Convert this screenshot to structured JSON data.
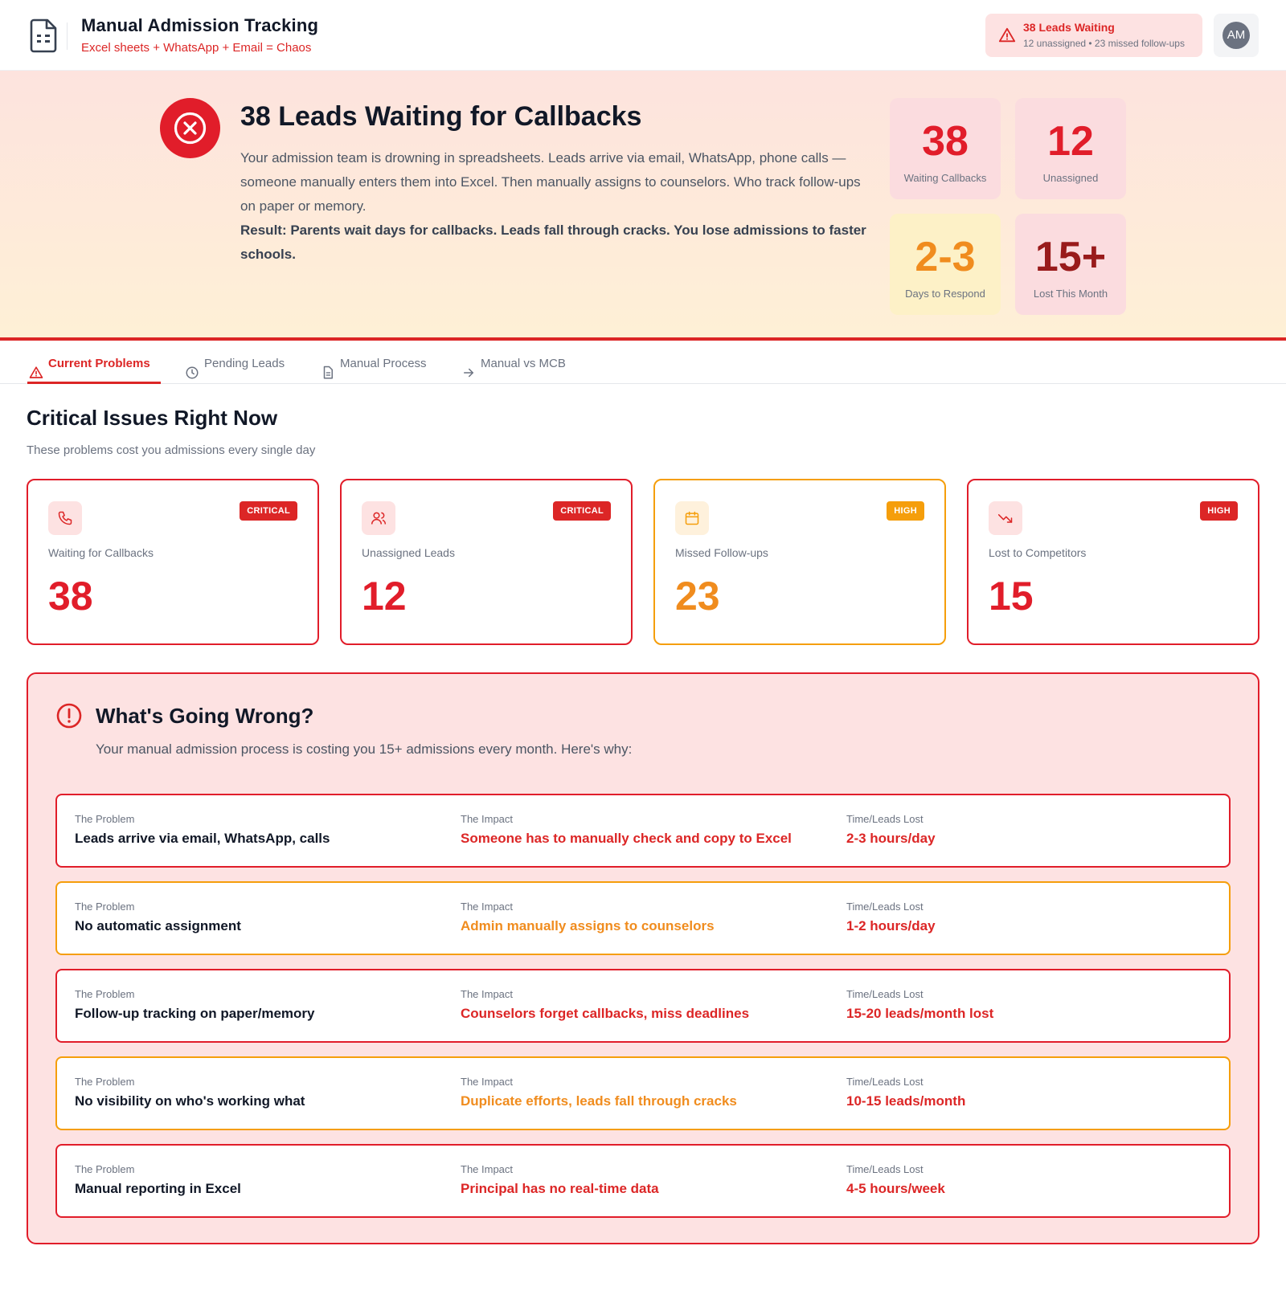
{
  "header": {
    "title": "Manual Admission Tracking",
    "subtitle": "Excel sheets + WhatsApp + Email = Chaos",
    "alert_title": "38 Leads Waiting",
    "alert_sub": "12 unassigned • 23 missed follow-ups",
    "avatar_initials": "AM"
  },
  "hero": {
    "title": "38 Leads Waiting for Callbacks",
    "body": "Your admission team is drowning in spreadsheets. Leads arrive via email, WhatsApp, phone calls — someone manually enters them into Excel. Then manually assigns to counselors. Who track follow-ups on paper or memory.",
    "result": "Result: Parents wait days for callbacks. Leads fall through cracks. You lose admissions to faster schools.",
    "stats": [
      {
        "value": "38",
        "label": "Waiting Callbacks"
      },
      {
        "value": "12",
        "label": "Unassigned"
      },
      {
        "value": "2-3",
        "label": "Days to Respond"
      },
      {
        "value": "15+",
        "label": "Lost This Month"
      }
    ]
  },
  "tabs": [
    {
      "label": "Current Problems",
      "icon": "warning-icon"
    },
    {
      "label": "Pending Leads",
      "icon": "clock-icon"
    },
    {
      "label": "Manual Process",
      "icon": "document-icon"
    },
    {
      "label": "Manual vs MCB",
      "icon": "arrow-right-icon"
    }
  ],
  "section": {
    "title": "Critical Issues Right Now",
    "subtitle": "These problems cost you admissions every single day"
  },
  "cards": [
    {
      "label": "Waiting for Callbacks",
      "value": "38",
      "badge": "CRITICAL",
      "icon": "phone-icon"
    },
    {
      "label": "Unassigned Leads",
      "value": "12",
      "badge": "CRITICAL",
      "icon": "users-icon"
    },
    {
      "label": "Missed Follow-ups",
      "value": "23",
      "badge": "HIGH",
      "icon": "calendar-icon"
    },
    {
      "label": "Lost to Competitors",
      "value": "15",
      "badge": "HIGH",
      "icon": "trending-down-icon"
    }
  ],
  "wrong": {
    "title": "What's Going Wrong?",
    "subtitle": "Your manual admission process is costing you 15+ admissions every month. Here's why:",
    "col_problem": "The Problem",
    "col_impact": "The Impact",
    "col_lost": "Time/Leads Lost",
    "rows": [
      {
        "problem": "Leads arrive via email, WhatsApp, calls",
        "impact": "Someone has to manually check and copy to Excel",
        "lost": "2-3 hours/day"
      },
      {
        "problem": "No automatic assignment",
        "impact": "Admin manually assigns to counselors",
        "lost": "1-2 hours/day"
      },
      {
        "problem": "Follow-up tracking on paper/memory",
        "impact": "Counselors forget callbacks, miss deadlines",
        "lost": "15-20 leads/month lost"
      },
      {
        "problem": "No visibility on who's working what",
        "impact": "Duplicate efforts, leads fall through cracks",
        "lost": "10-15 leads/month"
      },
      {
        "problem": "Manual reporting in Excel",
        "impact": "Principal has no real-time data",
        "lost": "4-5 hours/week"
      }
    ]
  },
  "colors": {
    "critical": "#dc2626",
    "high_orange": "#f59e0b",
    "hero_bg_top": "#fde3de",
    "hero_bg_bottom": "#fef0d6",
    "problem_panel_bg": "#fde2e2"
  }
}
